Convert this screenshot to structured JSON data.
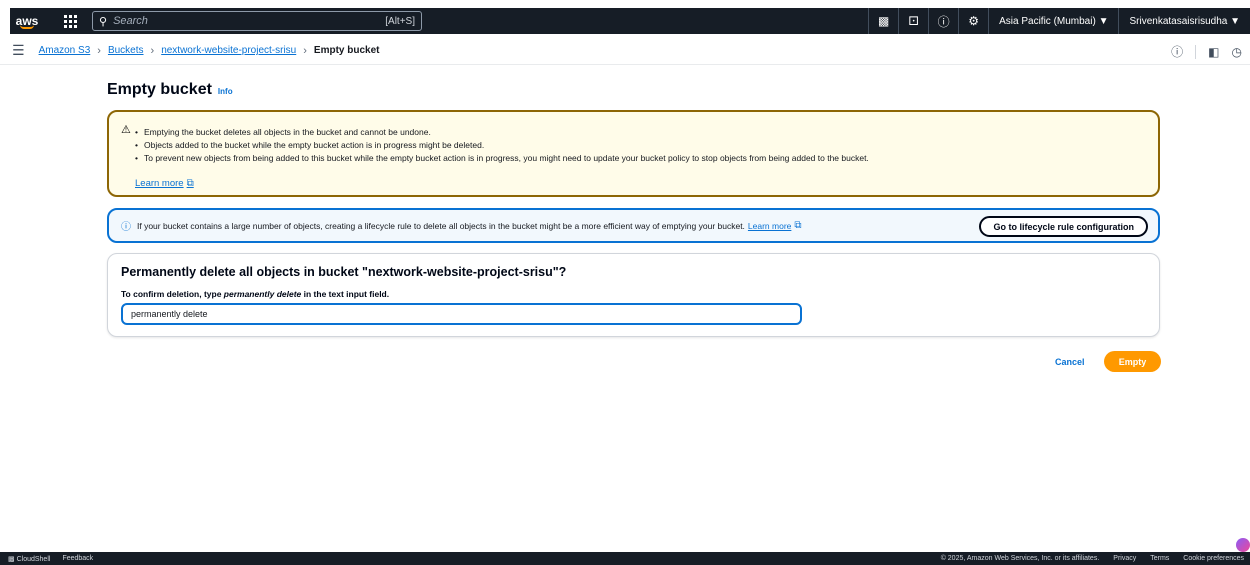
{
  "topbar": {
    "logo": "aws",
    "search_placeholder": "Search",
    "search_shortcut": "[Alt+S]",
    "region": "Asia Pacific (Mumbai) ▼",
    "account": "Srivenkatasaisrisudha ▼"
  },
  "breadcrumb": {
    "items": [
      "Amazon S3",
      "Buckets",
      "nextwork-website-project-srisu"
    ],
    "current": "Empty bucket"
  },
  "page": {
    "title": "Empty bucket",
    "info_link": "Info"
  },
  "warning": {
    "items": [
      "Emptying the bucket deletes all objects in the bucket and cannot be undone.",
      "Objects added to the bucket while the empty bucket action is in progress might be deleted.",
      "To prevent new objects from being added to this bucket while the empty bucket action is in progress, you might need to update your bucket policy to stop objects from being added to the bucket."
    ],
    "learn_more": "Learn more"
  },
  "info_alert": {
    "text": "If your bucket contains a large number of objects, creating a lifecycle rule to delete all objects in the bucket might be a more efficient way of emptying your bucket.",
    "learn_more": "Learn more",
    "button": "Go to lifecycle rule configuration"
  },
  "confirm": {
    "heading": "Permanently delete all objects in bucket \"nextwork-website-project-srisu\"?",
    "label_prefix": "To confirm deletion, type ",
    "label_emph": "permanently delete",
    "label_suffix": " in the text input field.",
    "input_value": "permanently delete"
  },
  "actions": {
    "cancel": "Cancel",
    "empty": "Empty"
  },
  "footer": {
    "cloudshell": "CloudShell",
    "feedback": "Feedback",
    "copyright": "© 2025, Amazon Web Services, Inc. or its affiliates.",
    "privacy": "Privacy",
    "terms": "Terms",
    "cookies": "Cookie preferences"
  },
  "colors": {
    "accent_orange": "#ff9900",
    "link_blue": "#0972d3",
    "nav_dark": "#161d26",
    "warning_bg": "#fffce9",
    "warning_border": "#8d6605",
    "info_bg": "#f2f8fd"
  }
}
